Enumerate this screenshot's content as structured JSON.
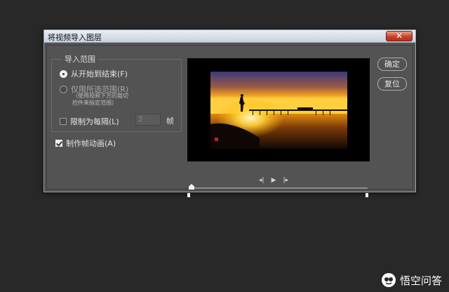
{
  "dialog": {
    "title": "将视频导入图层",
    "close_label": "✕",
    "range_group_title": "导入范围",
    "option_from_start_to_end": "从开始到结束(F)",
    "option_selected_range": "仅限所选范围(R)",
    "selected_range_note_line1": "（使用视频下方的裁切",
    "selected_range_note_line2": "控件来指定范围）",
    "limit_every_label": "限制为每隔(L)",
    "limit_frames_value": "2",
    "frames_unit": "帧",
    "make_frame_animation_label": "制作帧动画(A)",
    "ok_label": "确定",
    "reset_label": "复位"
  },
  "preview": {
    "transport_prev": "◂|",
    "transport_play": "▶",
    "transport_next": "|▸"
  },
  "watermark": {
    "text": "悟空问答"
  }
}
